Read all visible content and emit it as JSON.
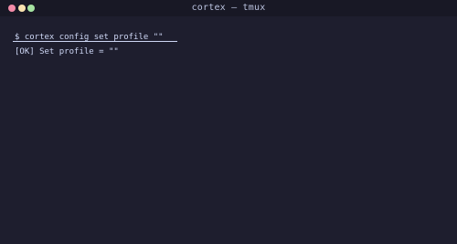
{
  "window": {
    "title": "cortex — tmux",
    "traffic_lights": {
      "close_color": "#f38ba8",
      "minimize_color": "#f9e2af",
      "maximize_color": "#a6e3a1"
    }
  },
  "terminal": {
    "lines": [
      "$ cortex config set profile \"\"",
      "[OK] Set profile = \"\""
    ]
  },
  "colors": {
    "background": "#1e1e2e",
    "titlebar": "#181825",
    "foreground": "#cdd6f4"
  }
}
